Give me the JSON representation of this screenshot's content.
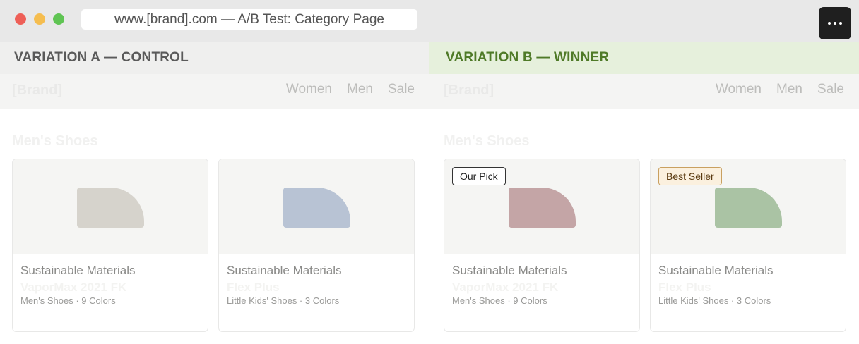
{
  "window": {
    "url": "www.[brand].com — A/B Test: Category Page",
    "menu_icon": "ellipsis-icon"
  },
  "variations": [
    {
      "label": "VARIATION A — CONTROL",
      "site": {
        "brand": "[Brand]",
        "nav": [
          "Women",
          "Men",
          "Sale"
        ],
        "section_title": "Men's Shoes"
      },
      "products": [
        {
          "badge": "",
          "tag": "Sustainable Materials",
          "name": "VaporMax 2021 FK",
          "meta": "Men's Shoes · 9 Colors",
          "swatch": "#d6d3cc"
        },
        {
          "badge": "",
          "tag": "Sustainable Materials",
          "name": "Flex Plus",
          "meta": "Little Kids' Shoes · 3 Colors",
          "swatch": "#b8c3d4"
        }
      ]
    },
    {
      "label": "VARIATION B — WINNER",
      "site": {
        "brand": "[Brand]",
        "nav": [
          "Women",
          "Men",
          "Sale"
        ],
        "section_title": "Men's Shoes"
      },
      "products": [
        {
          "badge": "Our Pick",
          "tag": "Sustainable Materials",
          "name": "VaporMax 2021 FK",
          "meta": "Men's Shoes · 9 Colors",
          "swatch": "#c4a5a6"
        },
        {
          "badge": "Best Seller",
          "tag": "Sustainable Materials",
          "name": "Flex Plus",
          "meta": "Little Kids' Shoes · 3 Colors",
          "swatch": "#aac3a4"
        }
      ]
    }
  ],
  "colors": {
    "control_header_bg": "#efefee",
    "winner_header_bg": "#e6f0dc",
    "winner_header_text": "#4f7a28"
  }
}
